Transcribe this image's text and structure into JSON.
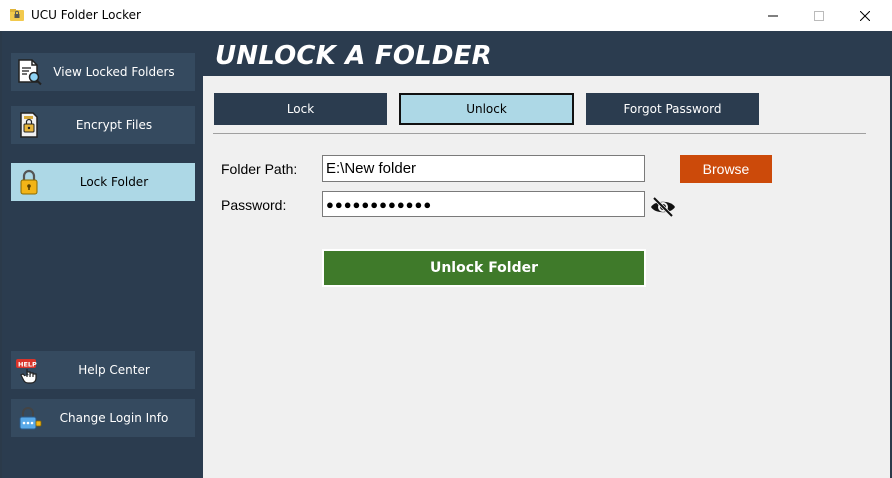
{
  "window": {
    "title": "UCU Folder Locker",
    "controls": {
      "minimize": "minimize",
      "maximize": "maximize",
      "close": "close"
    }
  },
  "colors": {
    "sidebar_bg": "#2b3c4f",
    "button_bg": "#354a5f",
    "active_bg": "#add8e6",
    "main_bg": "#f0f0f0",
    "browse_bg": "#cc4a0a",
    "unlock_bg": "#3f7a2a"
  },
  "sidebar": {
    "items": [
      {
        "label": "View Locked Folders",
        "icon": "document-search-icon",
        "active": false
      },
      {
        "label": "Encrypt Files",
        "icon": "encrypted-file-icon",
        "active": false
      },
      {
        "label": "Lock Folder",
        "icon": "padlock-icon",
        "active": true
      },
      {
        "label": "Help Center",
        "icon": "help-hand-icon",
        "active": false
      },
      {
        "label": "Change Login Info",
        "icon": "lock-key-icon",
        "active": false
      }
    ]
  },
  "main": {
    "title": "UNLOCK A FOLDER",
    "tabs": [
      {
        "label": "Lock",
        "active": false
      },
      {
        "label": "Unlock",
        "active": true
      },
      {
        "label": "Forgot Password",
        "active": false
      }
    ],
    "form": {
      "folder_path_label": "Folder Path:",
      "folder_path_value": "E:\\New folder",
      "browse_label": "Browse",
      "password_label": "Password:",
      "password_value": "●●●●●●●●●●●●",
      "password_toggle_icon": "eye-slash-icon",
      "submit_label": "Unlock Folder"
    }
  }
}
